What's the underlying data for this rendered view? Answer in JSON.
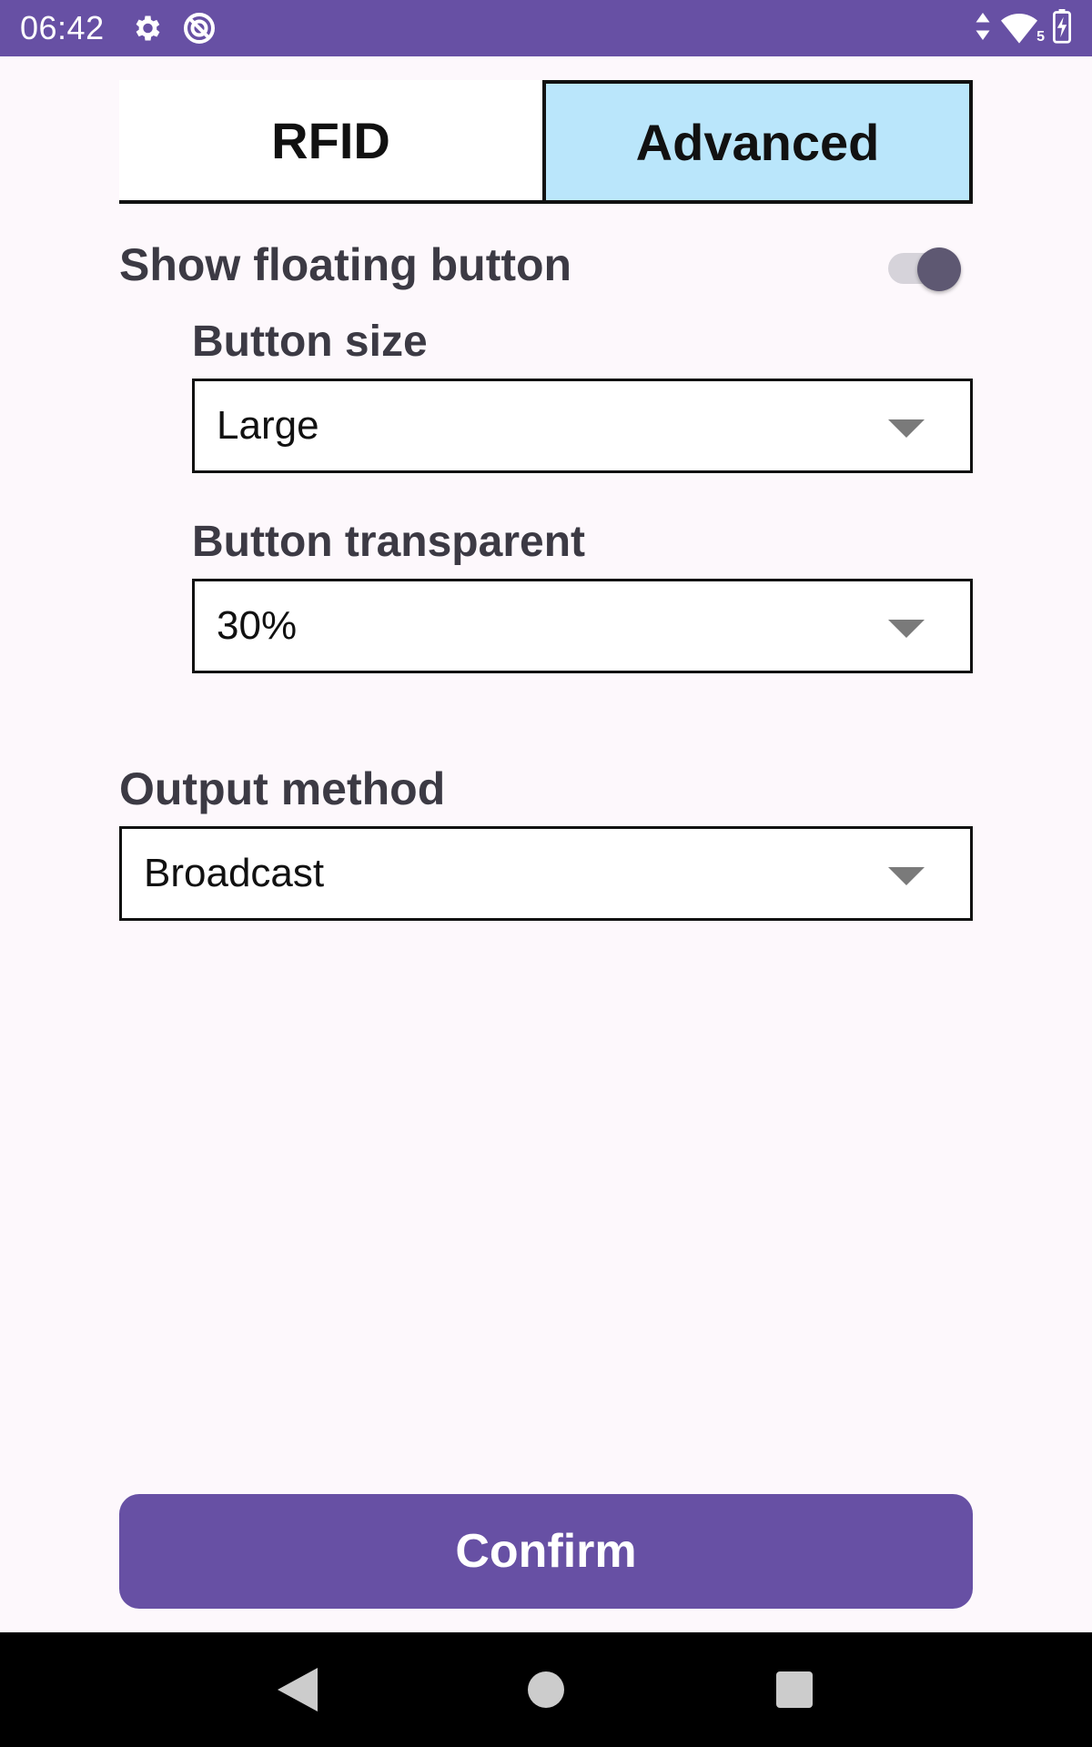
{
  "status_bar": {
    "time": "06:42",
    "icons": [
      "gear-icon",
      "sync-icon",
      "data-arrows-icon",
      "wifi-icon",
      "battery-charging-icon"
    ],
    "wifi_badge": "5"
  },
  "tabs": [
    {
      "label": "RFID",
      "active": false
    },
    {
      "label": "Advanced",
      "active": true
    }
  ],
  "floating_button": {
    "label": "Show floating button",
    "enabled": true
  },
  "button_size": {
    "label": "Button size",
    "value": "Large"
  },
  "button_transparent": {
    "label": "Button transparent",
    "value": "30%"
  },
  "output_method": {
    "label": "Output method",
    "value": "Broadcast"
  },
  "confirm_label": "Confirm",
  "colors": {
    "accent": "#6750a4",
    "active_tab": "#bae6fb",
    "background": "#fdf8fc"
  },
  "nav_bar": {
    "icons": [
      "back-icon",
      "home-icon",
      "recents-icon"
    ]
  }
}
